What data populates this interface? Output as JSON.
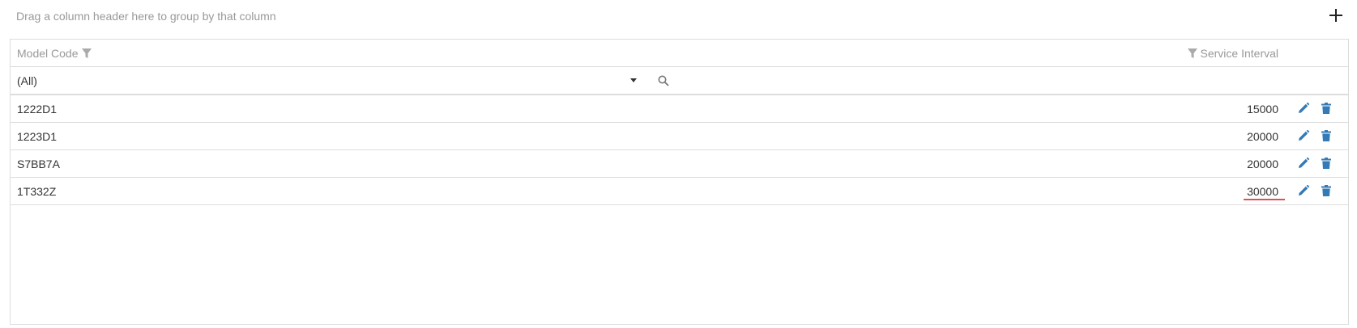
{
  "group_panel": {
    "hint": "Drag a column header here to group by that column",
    "add_icon": "plus-icon"
  },
  "columns": {
    "model_code": "Model Code",
    "service_interval": "Service Interval"
  },
  "filter": {
    "model_code_value": "(All)"
  },
  "rows": [
    {
      "model_code": "1222D1",
      "service_interval": "15000"
    },
    {
      "model_code": "1223D1",
      "service_interval": "20000"
    },
    {
      "model_code": "S7BB7A",
      "service_interval": "20000"
    },
    {
      "model_code": "1T332Z",
      "service_interval": "30000"
    }
  ],
  "colors": {
    "action_icon": "#337ab7",
    "validation_underline": "#d9534f",
    "header_text": "#999999"
  }
}
